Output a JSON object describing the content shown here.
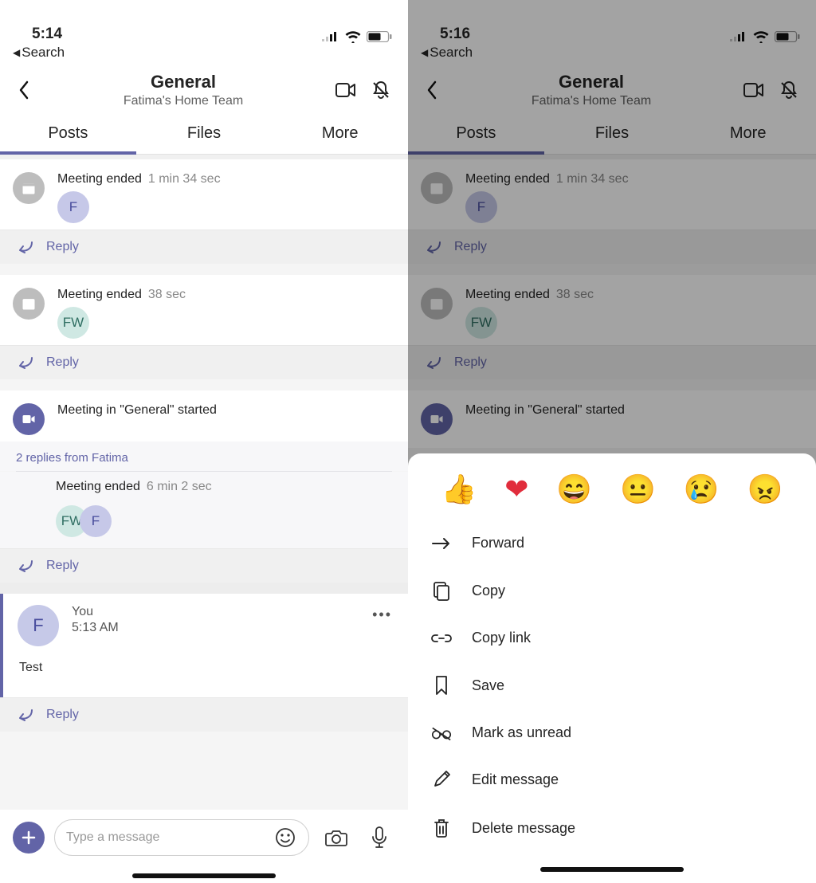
{
  "left": {
    "status": {
      "time": "5:14",
      "back_label": "Search"
    },
    "header": {
      "title": "General",
      "subtitle": "Fatima's Home Team"
    },
    "tabs": {
      "posts": "Posts",
      "files": "Files",
      "more": "More"
    },
    "feed": {
      "m1": {
        "label": "Meeting ended",
        "dur": "1 min 34 sec",
        "avatar": "F"
      },
      "m2": {
        "label": "Meeting ended",
        "dur": "38 sec",
        "avatar": "FW"
      },
      "m3": {
        "start": "Meeting in \"General\"  started",
        "replies_text": "2 replies from Fatima",
        "end_label": "Meeting ended",
        "end_dur": "6 min 2 sec",
        "av1": "FW",
        "av2": "F"
      },
      "msg": {
        "sender": "You",
        "time": "5:13 AM",
        "body": "Test",
        "avatar": "F"
      },
      "reply": "Reply"
    },
    "composer": {
      "placeholder": "Type a message"
    }
  },
  "right": {
    "status": {
      "time": "5:16",
      "back_label": "Search"
    },
    "sheet_actions": {
      "forward": "Forward",
      "copy": "Copy",
      "copy_link": "Copy link",
      "save": "Save",
      "mark_unread": "Mark as unread",
      "edit": "Edit message",
      "delete": "Delete message"
    },
    "reactions": {
      "r1": "👍",
      "r2": "❤",
      "r3": "😄",
      "r4": "😐",
      "r5": "😢",
      "r6": "😠"
    }
  }
}
